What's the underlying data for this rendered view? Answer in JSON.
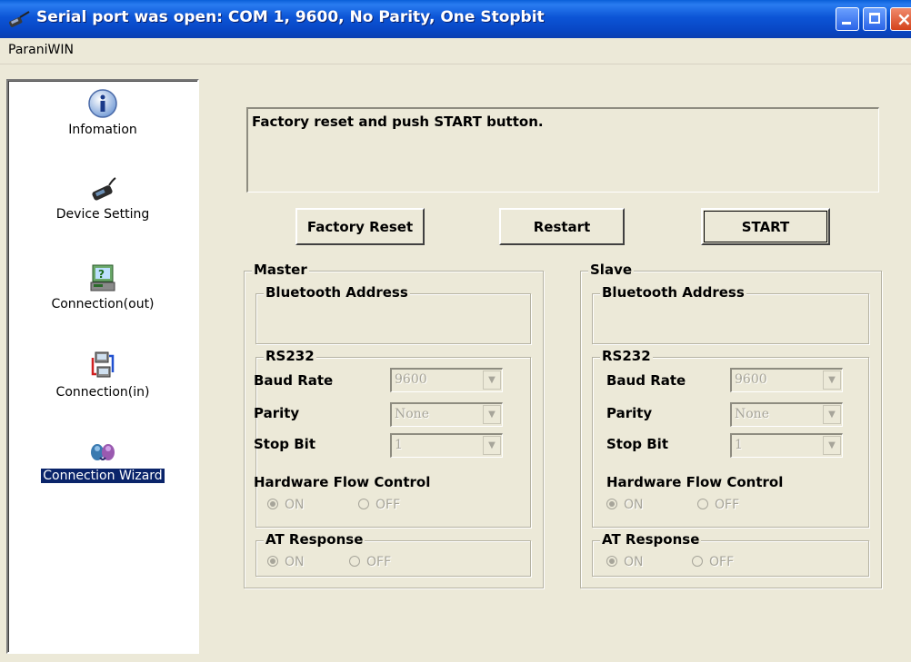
{
  "window": {
    "title": "Serial port was open: COM 1, 9600, No Parity, One Stopbit",
    "title_icon": "serial-cable-icon"
  },
  "menubar": {
    "items": [
      "ParaniWIN"
    ]
  },
  "sidebar": {
    "items": [
      {
        "label": "Infomation",
        "icon": "info-icon",
        "selected": false
      },
      {
        "label": "Device Setting",
        "icon": "device-icon",
        "selected": false
      },
      {
        "label": "Connection(out)",
        "icon": "connection-out-icon",
        "selected": false
      },
      {
        "label": "Connection(in)",
        "icon": "connection-in-icon",
        "selected": false
      },
      {
        "label": "Connection Wizard",
        "icon": "wizard-icon",
        "selected": true
      }
    ]
  },
  "message": "Factory reset and push START button.",
  "buttons": {
    "factory_reset": "Factory Reset",
    "restart": "Restart",
    "start": "START"
  },
  "labels": {
    "bluetooth_address": "Bluetooth Address",
    "rs232": "RS232",
    "baud_rate": "Baud Rate",
    "parity": "Parity",
    "stop_bit": "Stop Bit",
    "hardware_flow_control": "Hardware Flow Control",
    "at_response": "AT Response",
    "on": "ON",
    "off": "OFF"
  },
  "master": {
    "title": "Master",
    "bluetooth_address": "",
    "baud_rate": "9600",
    "parity": "None",
    "stop_bit": "1",
    "hardware_flow_control": "ON",
    "at_response": "ON"
  },
  "slave": {
    "title": "Slave",
    "bluetooth_address": "",
    "baud_rate": "9600",
    "parity": "None",
    "stop_bit": "1",
    "hardware_flow_control": "ON",
    "at_response": "ON"
  },
  "colors": {
    "titlebar": "#0846c4",
    "face": "#ece9d8",
    "selection": "#0a246a",
    "disabled_text": "#a7a59a"
  }
}
